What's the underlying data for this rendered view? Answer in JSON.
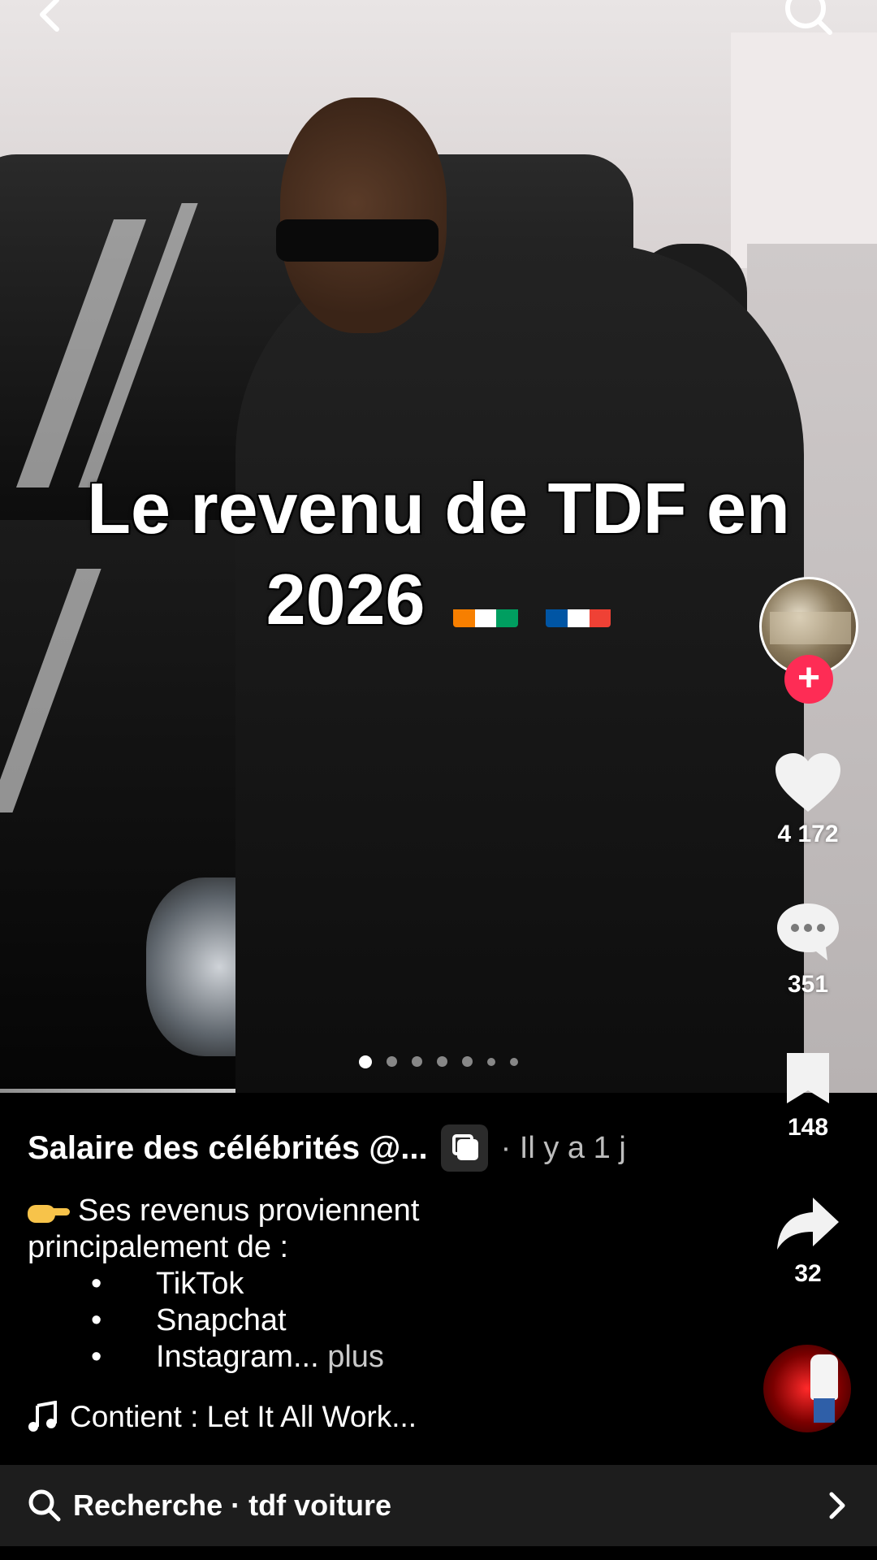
{
  "overlay": {
    "title_line1": "Le revenu de TDF en",
    "title_line2": "2026"
  },
  "carousel": {
    "total": 7,
    "active_index": 0
  },
  "rail": {
    "likes": "4 172",
    "comments": "351",
    "saves": "148",
    "shares": "32",
    "follow_symbol": "+"
  },
  "caption": {
    "author": "Salaire des célébrités @...",
    "time": "· Il y a 1 j",
    "intro": "Ses revenus proviennent",
    "intro2": "principalement de :",
    "bullet": "•",
    "items": [
      "TikTok",
      "Snapchat",
      "Instagram..."
    ],
    "more": "plus",
    "music": "Contient : Let It All Work..."
  },
  "search": {
    "label": "Recherche · tdf voiture"
  },
  "colors": {
    "accent": "#fe2c55",
    "search_bg": "#1d1d1d"
  },
  "icons": [
    "back-icon",
    "search-icon",
    "heart-icon",
    "comment-icon",
    "bookmark-icon",
    "share-icon",
    "music-note-icon",
    "chevron-right-icon",
    "photo-mode-icon",
    "pointing-hand-emoji",
    "cote-divoire-flag",
    "france-flag"
  ]
}
